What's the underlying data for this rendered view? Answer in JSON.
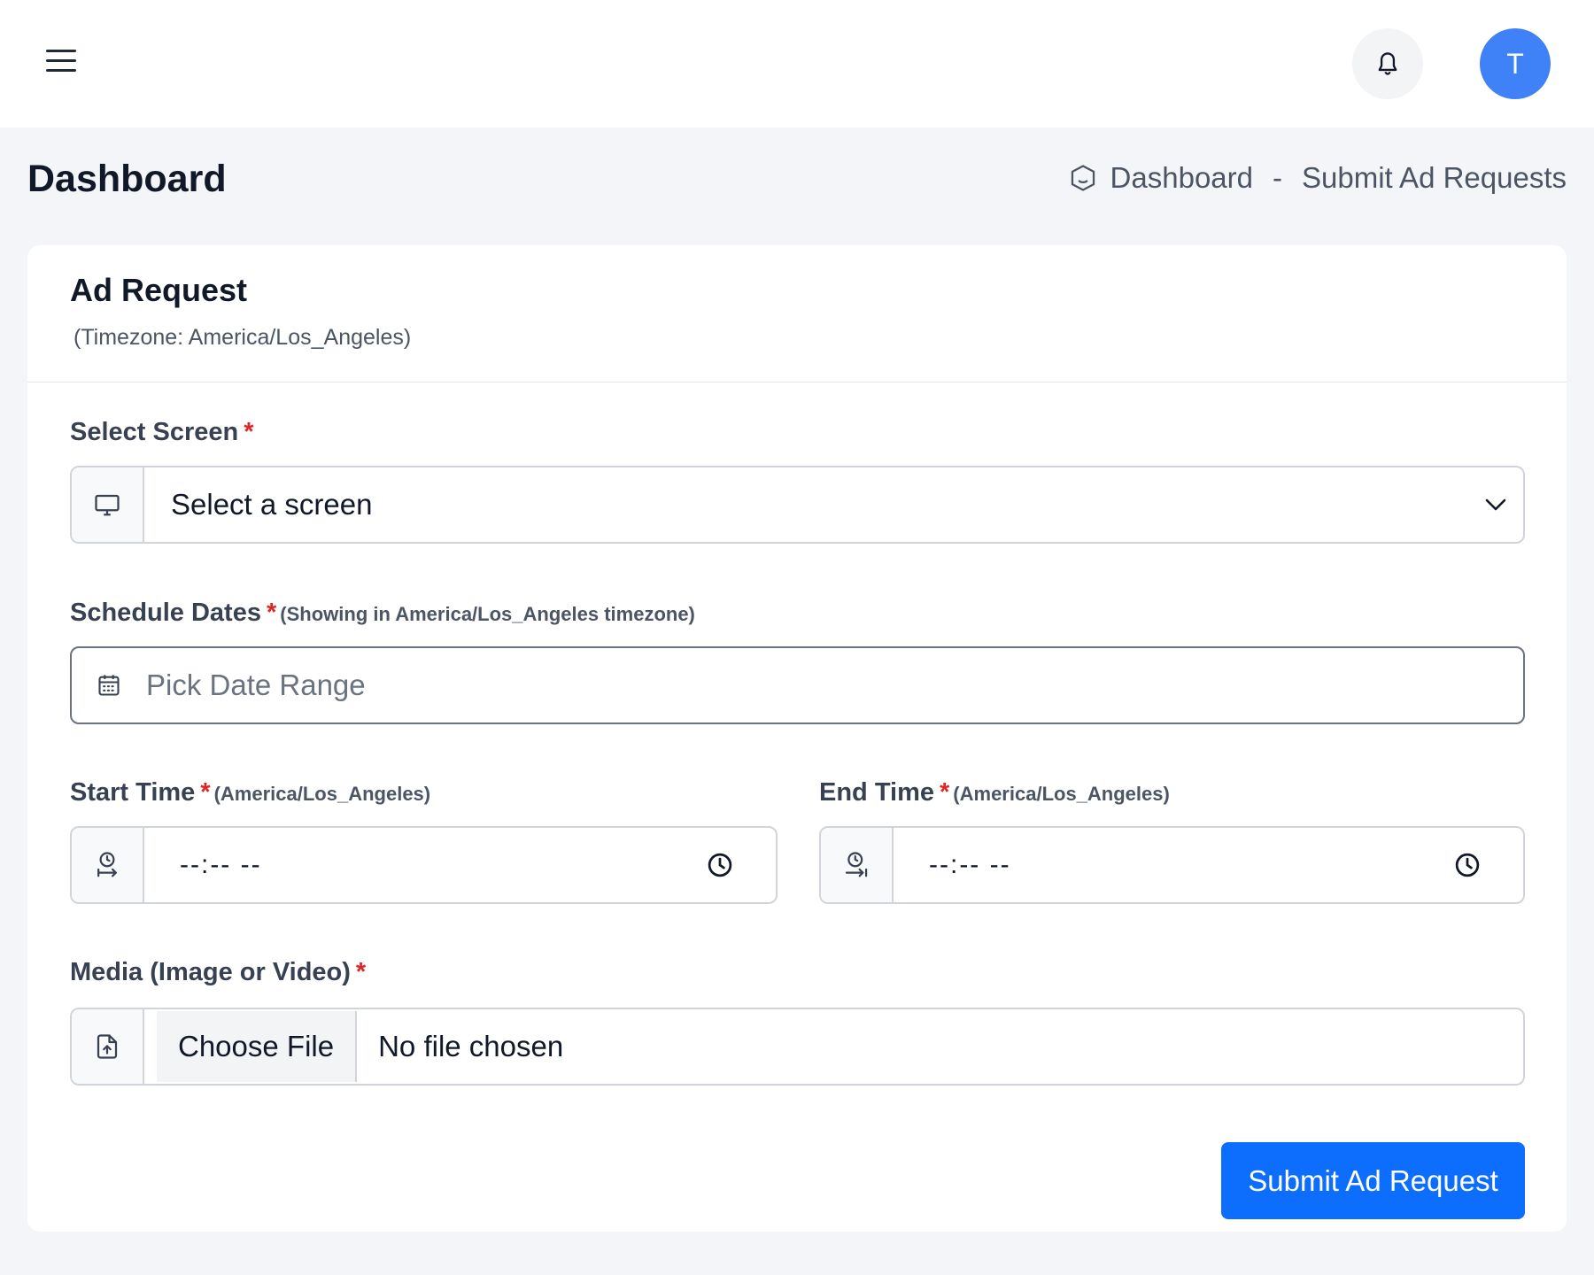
{
  "header": {
    "menu_icon": "hamburger-menu-icon",
    "notification_icon": "bell-icon",
    "avatar_initial": "T",
    "avatar_color": "#3f82f7"
  },
  "page": {
    "title": "Dashboard",
    "breadcrumb": {
      "home_icon": "home-icon",
      "home_label": "Dashboard",
      "separator": "-",
      "current": "Submit Ad Requests"
    }
  },
  "card": {
    "title": "Ad Request",
    "subtitle": "(Timezone: America/Los_Angeles)"
  },
  "form": {
    "screen": {
      "label": "Select Screen",
      "required": "*",
      "icon": "monitor-icon",
      "selected": "Select a screen"
    },
    "dates": {
      "label": "Schedule Dates",
      "required": "*",
      "hint": "(Showing in America/Los_Angeles timezone)",
      "icon": "calendar-icon",
      "placeholder": "Pick Date Range"
    },
    "start_time": {
      "label": "Start Time",
      "required": "*",
      "hint": "(America/Los_Angeles)",
      "icon": "clock-start-icon",
      "value": "--:-- --"
    },
    "end_time": {
      "label": "End Time",
      "required": "*",
      "hint": "(America/Los_Angeles)",
      "icon": "clock-end-icon",
      "value": "--:-- --"
    },
    "media": {
      "label": "Media (Image or Video)",
      "required": "*",
      "icon": "file-upload-icon",
      "button": "Choose File",
      "status": "No file chosen"
    },
    "submit_label": "Submit Ad Request",
    "submit_color": "#0d6efd"
  }
}
